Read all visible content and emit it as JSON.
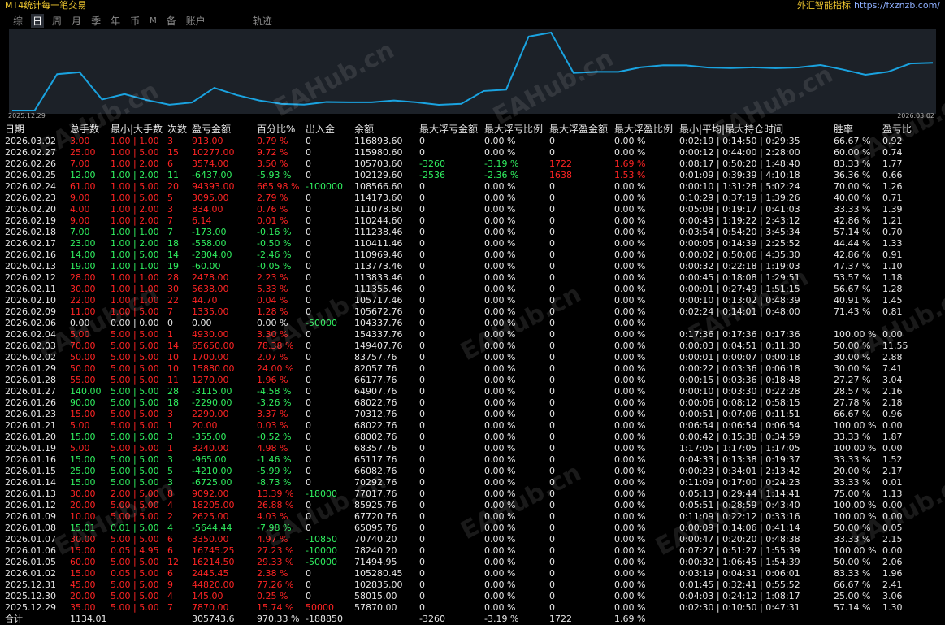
{
  "app_title": "MT4统计每一笔交易",
  "site": {
    "brand": "外汇智能指标",
    "url": "https://fxznzb.com/"
  },
  "tabs": [
    "综",
    "日",
    "周",
    "月",
    "季",
    "年",
    "币",
    "M",
    "备",
    "账户",
    "轨迹"
  ],
  "active_tab": "日",
  "chart": {
    "start_date": "2025.12.29",
    "end_date": "2026.03.02",
    "line_color": "#1aa3e0",
    "series": [
      57870,
      58015,
      102835,
      105280.45,
      71494.95,
      78240.2,
      70740.2,
      65095.76,
      67720.76,
      85925.76,
      77017.76,
      70292.76,
      66082.76,
      65117.76,
      68357.76,
      68002.76,
      68022.76,
      70312.76,
      68022.76,
      64907.76,
      66177.76,
      82057.76,
      83757.76,
      149407.76,
      154337.76,
      104337.76,
      105672.76,
      105717.46,
      111355.46,
      113833.46,
      113773.46,
      110969.46,
      110411.46,
      111238.46,
      110244.6,
      111078.6,
      114173.6,
      108566.6,
      102129.6,
      105703.6,
      115980.6,
      116893.6
    ]
  },
  "watermark": "EAHub.cn",
  "headers": [
    "日期",
    "总手数",
    "最小|大手数",
    "次数",
    "盈亏金额",
    "百分比%",
    "出入金",
    "余额",
    "最大浮亏金额",
    "最大浮亏比例",
    "最大浮盈金额",
    "最大浮盈比例",
    "最小|平均|最大持仓时间",
    "胜率",
    "盈亏比"
  ],
  "rows": [
    [
      "2026.03.02",
      "3.00",
      "1.00 | 1.00",
      "3",
      "913.00",
      "0.79 %",
      "0",
      "116893.60",
      "0",
      "0.00 %",
      "0",
      "0.00 %",
      "0:02:19 | 0:14:50 | 0:29:35",
      "66.67 %",
      "0.92"
    ],
    [
      "2026.02.27",
      "25.00",
      "1.00 | 5.00",
      "15",
      "10277.00",
      "9.72 %",
      "0",
      "115980.60",
      "0",
      "0.00 %",
      "0",
      "0.00 %",
      "0:00:12 | 0:44:00 | 2:28:00",
      "60.00 %",
      "0.74"
    ],
    [
      "2026.02.26",
      "7.00",
      "1.00 | 2.00",
      "6",
      "3574.00",
      "3.50 %",
      "0",
      "105703.60",
      "-3260",
      "-3.19 %",
      "1722",
      "1.69 %",
      "0:08:17 | 0:50:20 | 1:48:40",
      "83.33 %",
      "1.77"
    ],
    [
      "2026.02.25",
      "12.00",
      "1.00 | 2.00",
      "11",
      "-6437.00",
      "-5.93 %",
      "0",
      "102129.60",
      "-2536",
      "-2.36 %",
      "1638",
      "1.53 %",
      "0:01:09 | 0:39:39 | 4:10:18",
      "36.36 %",
      "0.66"
    ],
    [
      "2026.02.24",
      "61.00",
      "1.00 | 5.00",
      "20",
      "94393.00",
      "665.98 %",
      "-100000",
      "108566.60",
      "0",
      "0.00 %",
      "0",
      "0.00 %",
      "0:00:10 | 1:31:28 | 5:02:24",
      "70.00 %",
      "1.26"
    ],
    [
      "2026.02.23",
      "9.00",
      "1.00 | 5.00",
      "5",
      "3095.00",
      "2.79 %",
      "0",
      "114173.60",
      "0",
      "0.00 %",
      "0",
      "0.00 %",
      "0:10:29 | 0:37:19 | 1:39:26",
      "40.00 %",
      "0.71"
    ],
    [
      "2026.02.20",
      "4.00",
      "1.00 | 2.00",
      "3",
      "834.00",
      "0.76 %",
      "0",
      "111078.60",
      "0",
      "0.00 %",
      "0",
      "0.00 %",
      "0:05:08 | 0:19:17 | 0:41:03",
      "33.33 %",
      "1.39"
    ],
    [
      "2026.02.19",
      "9.00",
      "1.00 | 2.00",
      "7",
      "6.14",
      "0.01 %",
      "0",
      "110244.60",
      "0",
      "0.00 %",
      "0",
      "0.00 %",
      "0:00:43 | 1:19:22 | 2:43:12",
      "42.86 %",
      "1.21"
    ],
    [
      "2026.02.18",
      "7.00",
      "1.00 | 1.00",
      "7",
      "-173.00",
      "-0.16 %",
      "0",
      "111238.46",
      "0",
      "0.00 %",
      "0",
      "0.00 %",
      "0:03:54 | 0:54:20 | 3:45:34",
      "57.14 %",
      "0.70"
    ],
    [
      "2026.02.17",
      "23.00",
      "1.00 | 2.00",
      "18",
      "-558.00",
      "-0.50 %",
      "0",
      "110411.46",
      "0",
      "0.00 %",
      "0",
      "0.00 %",
      "0:00:05 | 0:14:39 | 2:25:52",
      "44.44 %",
      "1.33"
    ],
    [
      "2026.02.16",
      "14.00",
      "1.00 | 5.00",
      "14",
      "-2804.00",
      "-2.46 %",
      "0",
      "110969.46",
      "0",
      "0.00 %",
      "0",
      "0.00 %",
      "0:00:02 | 0:50:06 | 4:35:30",
      "42.86 %",
      "0.91"
    ],
    [
      "2026.02.13",
      "19.00",
      "1.00 | 1.00",
      "19",
      "-60.00",
      "-0.05 %",
      "0",
      "113773.46",
      "0",
      "0.00 %",
      "0",
      "0.00 %",
      "0:00:32 | 0:22:18 | 1:19:03",
      "47.37 %",
      "1.10"
    ],
    [
      "2026.02.12",
      "28.00",
      "1.00 | 1.00",
      "28",
      "2478.00",
      "2.23 %",
      "0",
      "113833.46",
      "0",
      "0.00 %",
      "0",
      "0.00 %",
      "0:00:45 | 0:18:08 | 1:29:51",
      "53.57 %",
      "1.18"
    ],
    [
      "2026.02.11",
      "30.00",
      "1.00 | 1.00",
      "30",
      "5638.00",
      "5.33 %",
      "0",
      "111355.46",
      "0",
      "0.00 %",
      "0",
      "0.00 %",
      "0:00:01 | 0:27:49 | 1:51:15",
      "56.67 %",
      "1.28"
    ],
    [
      "2026.02.10",
      "22.00",
      "1.00 | 1.00",
      "22",
      "44.70",
      "0.04 %",
      "0",
      "105717.46",
      "0",
      "0.00 %",
      "0",
      "0.00 %",
      "0:00:10 | 0:13:02 | 0:48:39",
      "40.91 %",
      "1.45"
    ],
    [
      "2026.02.09",
      "11.00",
      "1.00 | 5.00",
      "7",
      "1335.00",
      "1.28 %",
      "0",
      "105672.76",
      "0",
      "0.00 %",
      "0",
      "0.00 %",
      "0:02:24 | 0:14:01 | 0:48:00",
      "71.43 %",
      "0.81"
    ],
    [
      "2026.02.06",
      "0.00",
      "0.00 | 0.00",
      "0",
      "0.00",
      "0.00 %",
      "-50000",
      "104337.76",
      "0",
      "0.00 %",
      "0",
      "0.00 %",
      "",
      "",
      ""
    ],
    [
      "2026.02.04",
      "5.00",
      "5.00 | 5.00",
      "1",
      "4930.00",
      "3.30 %",
      "0",
      "154337.76",
      "0",
      "0.00 %",
      "0",
      "0.00 %",
      "0:17:36 | 0:17:36 | 0:17:36",
      "100.00 %",
      "0.00"
    ],
    [
      "2026.02.03",
      "70.00",
      "5.00 | 5.00",
      "14",
      "65650.00",
      "78.38 %",
      "0",
      "149407.76",
      "0",
      "0.00 %",
      "0",
      "0.00 %",
      "0:00:03 | 0:04:51 | 0:11:30",
      "50.00 %",
      "11.55"
    ],
    [
      "2026.02.02",
      "50.00",
      "5.00 | 5.00",
      "10",
      "1700.00",
      "2.07 %",
      "0",
      "83757.76",
      "0",
      "0.00 %",
      "0",
      "0.00 %",
      "0:00:01 | 0:00:07 | 0:00:18",
      "30.00 %",
      "2.88"
    ],
    [
      "2026.01.29",
      "50.00",
      "5.00 | 5.00",
      "10",
      "15880.00",
      "24.00 %",
      "0",
      "82057.76",
      "0",
      "0.00 %",
      "0",
      "0.00 %",
      "0:00:22 | 0:03:36 | 0:06:18",
      "30.00 %",
      "7.41"
    ],
    [
      "2026.01.28",
      "55.00",
      "5.00 | 5.00",
      "11",
      "1270.00",
      "1.96 %",
      "0",
      "66177.76",
      "0",
      "0.00 %",
      "0",
      "0.00 %",
      "0:00:15 | 0:03:36 | 0:18:48",
      "27.27 %",
      "3.04"
    ],
    [
      "2026.01.27",
      "140.00",
      "5.00 | 5.00",
      "28",
      "-3115.00",
      "-4.58 %",
      "0",
      "64907.76",
      "0",
      "0.00 %",
      "0",
      "0.00 %",
      "0:00:10 | 0:03:30 | 0:22:28",
      "28.57 %",
      "2.16"
    ],
    [
      "2026.01.26",
      "90.00",
      "5.00 | 5.00",
      "18",
      "-2290.00",
      "-3.26 %",
      "0",
      "68022.76",
      "0",
      "0.00 %",
      "0",
      "0.00 %",
      "0:00:06 | 0:08:12 | 0:58:15",
      "27.78 %",
      "2.18"
    ],
    [
      "2026.01.23",
      "15.00",
      "5.00 | 5.00",
      "3",
      "2290.00",
      "3.37 %",
      "0",
      "70312.76",
      "0",
      "0.00 %",
      "0",
      "0.00 %",
      "0:00:51 | 0:07:06 | 0:11:51",
      "66.67 %",
      "0.96"
    ],
    [
      "2026.01.21",
      "5.00",
      "5.00 | 5.00",
      "1",
      "20.00",
      "0.03 %",
      "0",
      "68022.76",
      "0",
      "0.00 %",
      "0",
      "0.00 %",
      "0:06:54 | 0:06:54 | 0:06:54",
      "100.00 %",
      "0.00"
    ],
    [
      "2026.01.20",
      "15.00",
      "5.00 | 5.00",
      "3",
      "-355.00",
      "-0.52 %",
      "0",
      "68002.76",
      "0",
      "0.00 %",
      "0",
      "0.00 %",
      "0:00:42 | 0:15:38 | 0:34:59",
      "33.33 %",
      "1.87"
    ],
    [
      "2026.01.19",
      "5.00",
      "5.00 | 5.00",
      "1",
      "3240.00",
      "4.98 %",
      "0",
      "68357.76",
      "0",
      "0.00 %",
      "0",
      "0.00 %",
      "1:17:05 | 1:17:05 | 1:17:05",
      "100.00 %",
      "0.00"
    ],
    [
      "2026.01.16",
      "15.00",
      "5.00 | 5.00",
      "3",
      "-965.00",
      "-1.46 %",
      "0",
      "65117.76",
      "0",
      "0.00 %",
      "0",
      "0.00 %",
      "0:04:33 | 0:13:38 | 0:19:37",
      "33.33 %",
      "1.52"
    ],
    [
      "2026.01.15",
      "25.00",
      "5.00 | 5.00",
      "5",
      "-4210.00",
      "-5.99 %",
      "0",
      "66082.76",
      "0",
      "0.00 %",
      "0",
      "0.00 %",
      "0:00:23 | 0:34:01 | 2:13:42",
      "20.00 %",
      "2.17"
    ],
    [
      "2026.01.14",
      "15.00",
      "5.00 | 5.00",
      "3",
      "-6725.00",
      "-8.73 %",
      "0",
      "70292.76",
      "0",
      "0.00 %",
      "0",
      "0.00 %",
      "0:11:09 | 0:17:00 | 0:24:23",
      "33.33 %",
      "0.01"
    ],
    [
      "2026.01.13",
      "30.00",
      "2.00 | 5.00",
      "8",
      "9092.00",
      "13.39 %",
      "-18000",
      "77017.76",
      "0",
      "0.00 %",
      "0",
      "0.00 %",
      "0:05:13 | 0:29:44 | 1:14:41",
      "75.00 %",
      "1.13"
    ],
    [
      "2026.01.12",
      "20.00",
      "5.00 | 5.00",
      "4",
      "18205.00",
      "26.88 %",
      "0",
      "85925.76",
      "0",
      "0.00 %",
      "0",
      "0.00 %",
      "0:05:51 | 0:28:59 | 0:43:40",
      "100.00 %",
      "0.00"
    ],
    [
      "2026.01.09",
      "10.00",
      "5.00 | 5.00",
      "2",
      "2625.00",
      "4.03 %",
      "0",
      "67720.76",
      "0",
      "0.00 %",
      "0",
      "0.00 %",
      "0:11:09 | 0:22:12 | 0:33:16",
      "100.00 %",
      "0.00"
    ],
    [
      "2026.01.08",
      "15.01",
      "0.01 | 5.00",
      "4",
      "-5644.44",
      "-7.98 %",
      "0",
      "65095.76",
      "0",
      "0.00 %",
      "0",
      "0.00 %",
      "0:00:09 | 0:14:06 | 0:41:14",
      "50.00 %",
      "0.05"
    ],
    [
      "2026.01.07",
      "30.00",
      "5.00 | 5.00",
      "6",
      "3350.00",
      "4.97 %",
      "-10850",
      "70740.20",
      "0",
      "0.00 %",
      "0",
      "0.00 %",
      "0:00:47 | 0:20:20 | 0:48:38",
      "33.33 %",
      "2.15"
    ],
    [
      "2026.01.06",
      "15.00",
      "0.05 | 4.95",
      "6",
      "16745.25",
      "27.23 %",
      "-10000",
      "78240.20",
      "0",
      "0.00 %",
      "0",
      "0.00 %",
      "0:07:27 | 0:51:27 | 1:55:39",
      "100.00 %",
      "0.00"
    ],
    [
      "2026.01.05",
      "60.00",
      "5.00 | 5.00",
      "12",
      "16214.50",
      "29.33 %",
      "-50000",
      "71494.95",
      "0",
      "0.00 %",
      "0",
      "0.00 %",
      "0:00:32 | 1:06:45 | 1:54:39",
      "50.00 %",
      "2.06"
    ],
    [
      "2026.01.02",
      "15.00",
      "0.05 | 5.00",
      "6",
      "2445.45",
      "2.38 %",
      "0",
      "105280.45",
      "0",
      "0.00 %",
      "0",
      "0.00 %",
      "0:03:19 | 0:04:31 | 0:06:01",
      "83.33 %",
      "1.96"
    ],
    [
      "2025.12.31",
      "45.00",
      "5.00 | 5.00",
      "9",
      "44820.00",
      "77.26 %",
      "0",
      "102835.00",
      "0",
      "0.00 %",
      "0",
      "0.00 %",
      "0:01:45 | 0:32:41 | 0:55:52",
      "66.67 %",
      "2.41"
    ],
    [
      "2025.12.30",
      "20.00",
      "5.00 | 5.00",
      "4",
      "145.00",
      "0.25 %",
      "0",
      "58015.00",
      "0",
      "0.00 %",
      "0",
      "0.00 %",
      "0:04:03 | 0:24:12 | 1:08:17",
      "25.00 %",
      "3.06"
    ],
    [
      "2025.12.29",
      "35.00",
      "5.00 | 5.00",
      "7",
      "7870.00",
      "15.74 %",
      "50000",
      "57870.00",
      "0",
      "0.00 %",
      "0",
      "0.00 %",
      "0:02:30 | 0:10:50 | 0:47:31",
      "57.14 %",
      "1.30"
    ]
  ],
  "total": [
    "合计",
    "1134.01",
    "",
    "",
    "305743.6",
    "970.33 %",
    "-188850",
    "",
    "-3260",
    "-3.19 %",
    "1722",
    "1.69 %",
    "",
    "",
    ""
  ]
}
